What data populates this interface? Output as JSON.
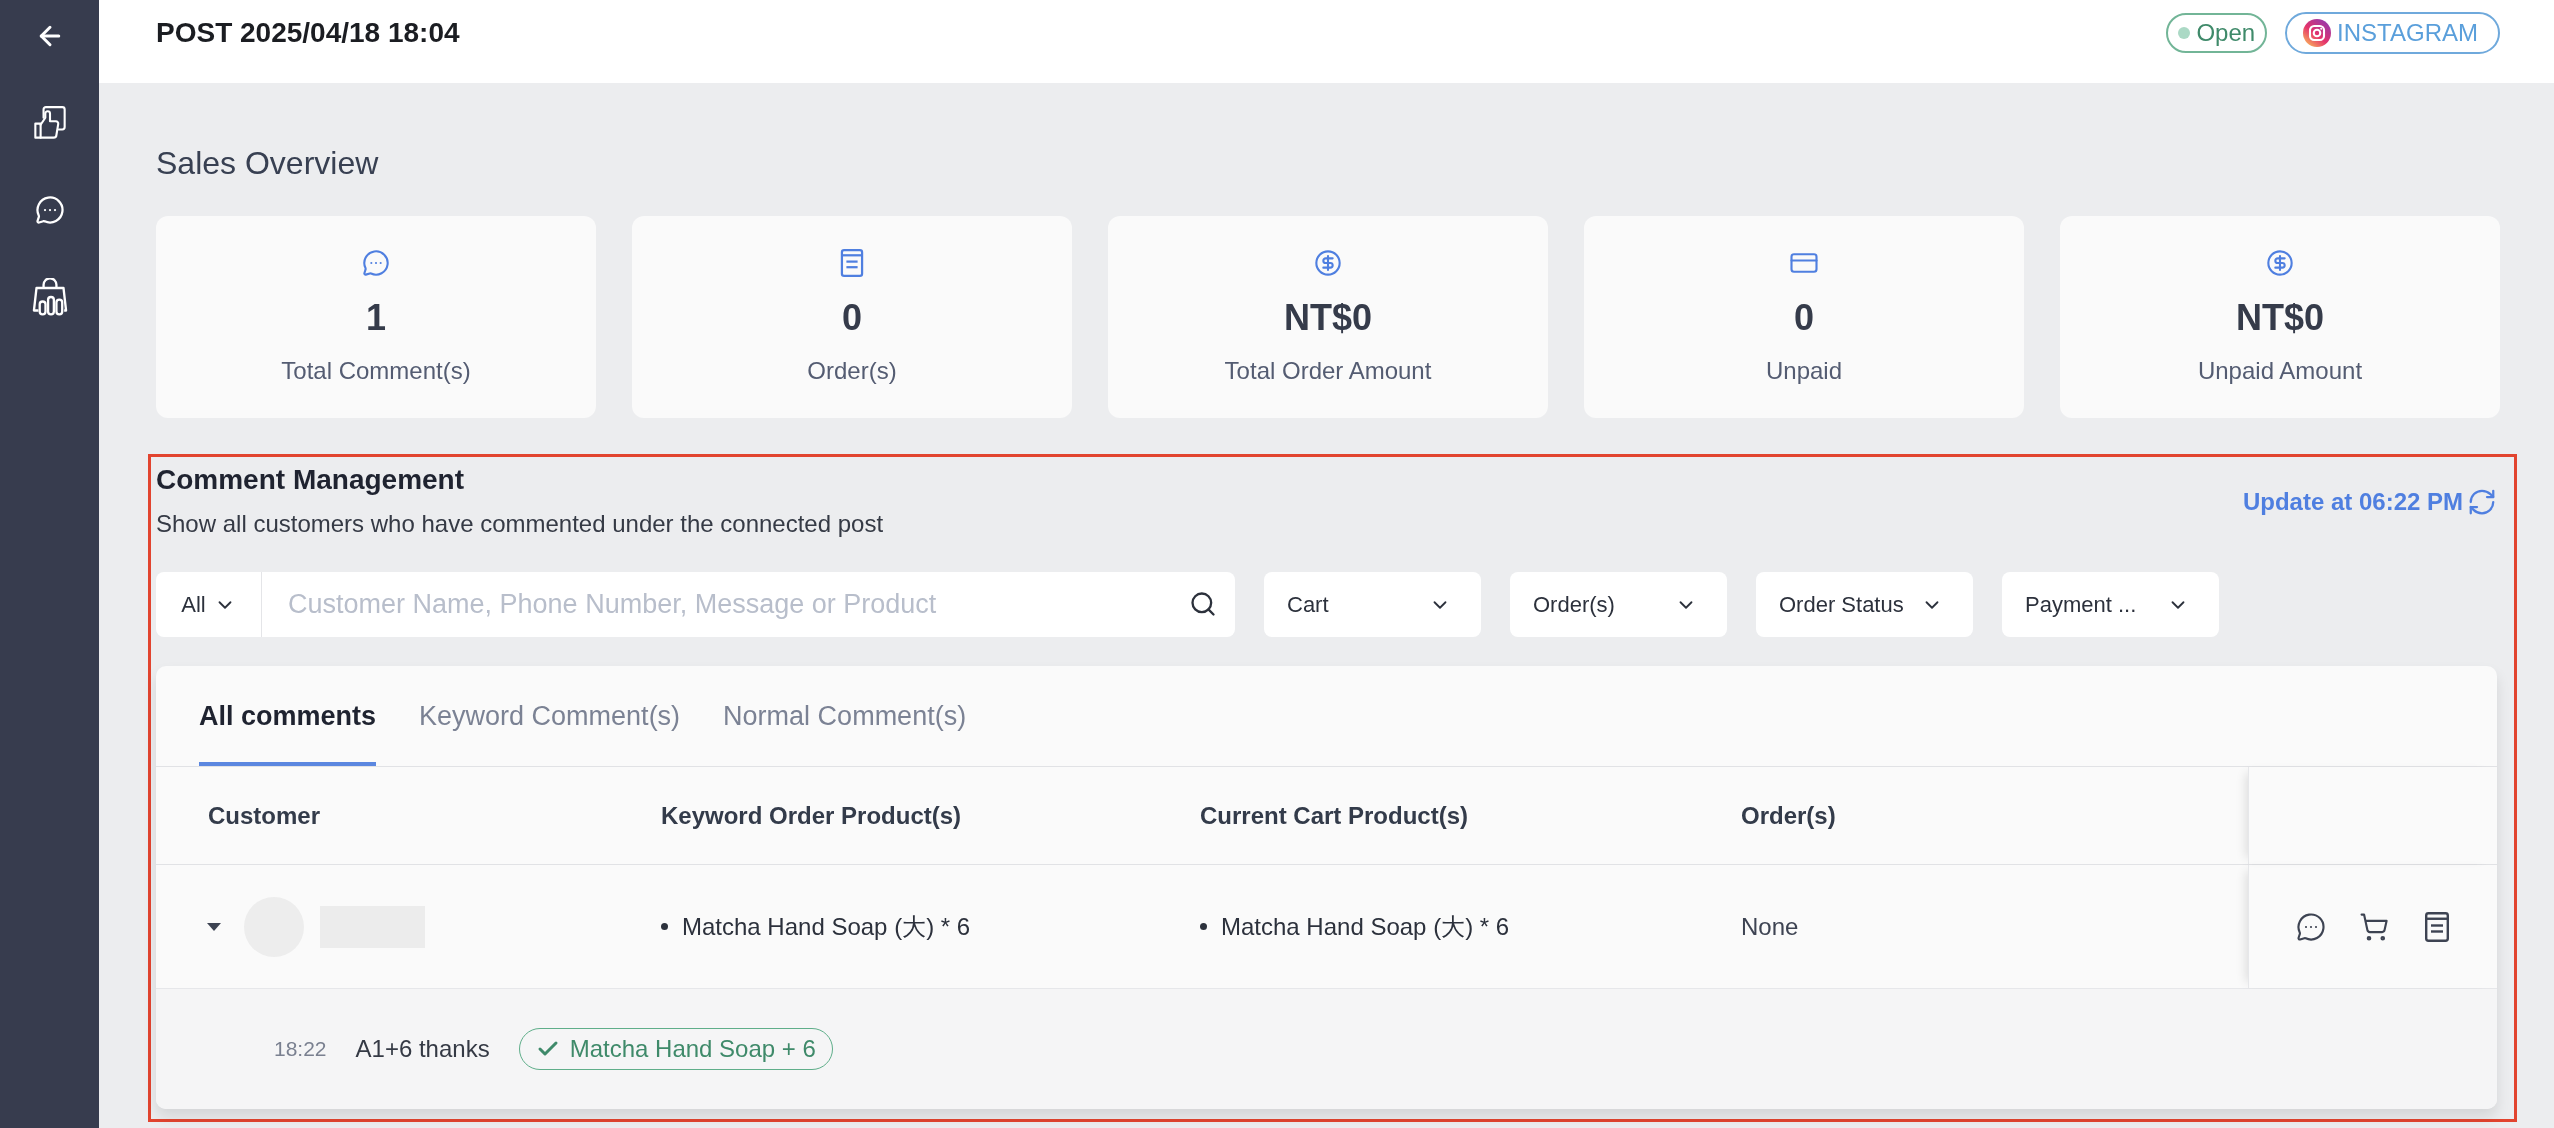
{
  "sidebar": {
    "items": [
      {
        "kind": "back"
      },
      {
        "kind": "likes"
      },
      {
        "kind": "comments"
      },
      {
        "kind": "sales"
      }
    ]
  },
  "header": {
    "title": "POST 2025/04/18 18:04",
    "status": "Open",
    "platform": "INSTAGRAM"
  },
  "sales_overview": {
    "title": "Sales Overview",
    "cards": [
      {
        "kind": "comment",
        "value": "1",
        "label": "Total Comment(s)"
      },
      {
        "kind": "order",
        "value": "0",
        "label": "Order(s)"
      },
      {
        "kind": "money",
        "value": "NT$0",
        "label": "Total Order Amount"
      },
      {
        "kind": "card",
        "value": "0",
        "label": "Unpaid"
      },
      {
        "kind": "money",
        "value": "NT$0",
        "label": "Unpaid Amount"
      }
    ]
  },
  "comment_management": {
    "title": "Comment Management",
    "subtitle": "Show all customers who have commented under the connected post",
    "update_label": "Update at 06:22 PM",
    "scope": "All",
    "search": {
      "placeholder": "Customer Name, Phone Number, Message or Product"
    },
    "filters": [
      "Cart",
      "Order(s)",
      "Order Status",
      "Payment ..."
    ],
    "tabs": [
      {
        "label": "All comments",
        "selected": true
      },
      {
        "label": "Keyword Comment(s)",
        "selected": false
      },
      {
        "label": "Normal Comment(s)",
        "selected": false
      }
    ],
    "table": {
      "columns": [
        "Customer",
        "Keyword Order Product(s)",
        "Current Cart Product(s)",
        "Order(s)"
      ],
      "rows": [
        {
          "expanded": true,
          "keyword_products": [
            "Matcha Hand Soap (大) * 6"
          ],
          "cart_products": [
            "Matcha Hand Soap (大) * 6"
          ],
          "orders": "None",
          "actions": [
            {
              "kind": "chat"
            },
            {
              "kind": "cart"
            },
            {
              "kind": "document"
            }
          ],
          "comments": [
            {
              "time": "18:22",
              "text": "A1+6 thanks",
              "tag": "Matcha Hand Soap + 6"
            }
          ]
        }
      ]
    }
  }
}
